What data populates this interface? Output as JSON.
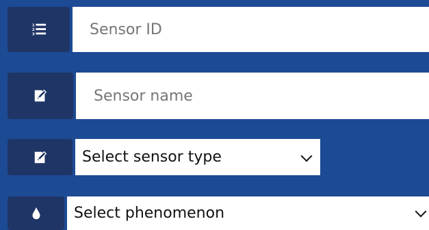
{
  "form": {
    "sensor_id": {
      "placeholder": "Sensor ID",
      "icon": "numbered-list-icon"
    },
    "sensor_name": {
      "placeholder": "Sensor name",
      "icon": "edit-icon"
    },
    "sensor_type": {
      "selected": "Select sensor type",
      "icon": "edit-icon"
    },
    "phenomenon": {
      "selected": "Select phenomenon",
      "icon": "drop-icon"
    }
  },
  "colors": {
    "background": "#1d4a94",
    "icon_box": "#1f3566",
    "field_background": "#ffffff",
    "placeholder_text": "#8c8c8c",
    "select_text": "#111111"
  }
}
